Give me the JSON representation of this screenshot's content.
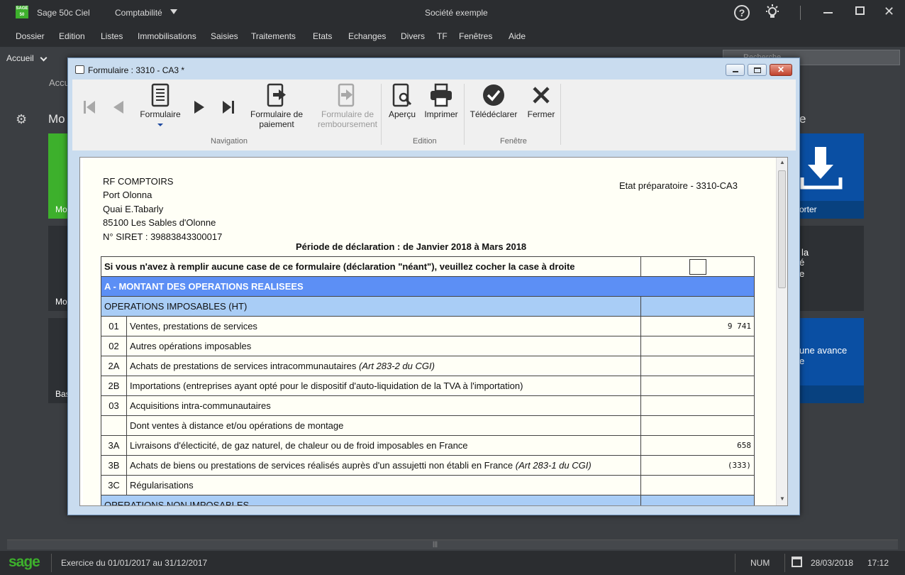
{
  "titlebar": {
    "app_name": "Sage 50c Ciel",
    "module": "Comptabilité",
    "company": "Société exemple",
    "logo_text": "SAGE 50"
  },
  "menu": {
    "items": [
      "Dossier",
      "Edition",
      "Listes",
      "Immobilisations",
      "Saisies",
      "Traitements",
      "Etats",
      "Echanges",
      "Divers",
      "TF",
      "Fenêtres",
      "Aide"
    ]
  },
  "navbar": {
    "home": "Accueil",
    "search_placeholder": "Recherche"
  },
  "background": {
    "breadcrumb": "Accu",
    "heading_left": "Mo",
    "heading_right": "e",
    "tiles": [
      {
        "label": "Mo",
        "color": "#3db02c"
      },
      {
        "label": "Mo",
        "color": "#2d3034"
      },
      {
        "label": "Bas",
        "color": "#2d3034"
      },
      {
        "label": "orter",
        "color": "#0a4fa3"
      },
      {
        "label_lines": [
          "la",
          "é",
          "e"
        ],
        "color": "#2d3034"
      },
      {
        "label_lines": [
          "une avance",
          "e"
        ],
        "color": "#0a4fa3"
      }
    ]
  },
  "modal": {
    "title": "Formulaire : 3310 - CA3 *",
    "toolbar": {
      "formulaire": "Formulaire",
      "formulaire_paiement": [
        "Formulaire de",
        "paiement"
      ],
      "formulaire_remboursement": [
        "Formulaire de",
        "remboursement"
      ],
      "apercu": "Aperçu",
      "imprimer": "Imprimer",
      "teledeclarer": "Télédéclarer",
      "fermer": "Fermer",
      "groups": {
        "navigation": "Navigation",
        "edition": "Edition",
        "fenetre": "Fenêtre"
      }
    },
    "document": {
      "address": [
        "RF COMPTOIRS",
        "Port Olonna",
        "Quai E.Tabarly",
        "85100 Les Sables d'Olonne",
        "N° SIRET : 39883843300017"
      ],
      "etat": "Etat préparatoire - 3310-CA3",
      "periode": "Période de déclaration : de Janvier 2018 à Mars 2018",
      "neant": "Si vous n'avez à remplir aucune case de ce formulaire (déclaration \"néant\"), veuillez cocher la case à droite",
      "section_a": "A - MONTANT DES OPERATIONS REALISEES",
      "subsection_imposables": "OPERATIONS IMPOSABLES (HT)",
      "rows": [
        {
          "code": "01",
          "label": "Ventes, prestations de services",
          "value": "9 741"
        },
        {
          "code": "02",
          "label": "Autres opérations imposables",
          "value": ""
        },
        {
          "code": "2A",
          "label": "Achats de prestations de services intracommunautaires",
          "italic": "(Art 283-2 du CGI)",
          "value": ""
        },
        {
          "code": "2B",
          "label": "Importations (entreprises ayant opté pour le dispositif d'auto-liquidation de la TVA à l'importation)",
          "value": ""
        },
        {
          "code": "03",
          "label": "Acquisitions intra-communautaires",
          "value": ""
        },
        {
          "code": "",
          "label": "Dont ventes à distance et/ou opérations de montage",
          "value": ""
        },
        {
          "code": "3A",
          "label": "Livraisons d'électicité, de gaz naturel, de chaleur ou de froid imposables en France",
          "value": "658"
        },
        {
          "code": "3B",
          "label": "Achats de biens ou prestations de services réalisés auprès d'un assujetti non établi en France",
          "italic": "(Art 283-1 du CGI)",
          "value": "(333)"
        },
        {
          "code": "3C",
          "label": "Régularisations",
          "value": ""
        }
      ],
      "subsection_non_imposables": "OPERATIONS NON IMPOSABLES"
    }
  },
  "statusbar": {
    "logo": "sage",
    "exercice": "Exercice du 01/01/2017 au 31/12/2017",
    "num": "NUM",
    "date": "28/03/2018",
    "time": "17:12"
  }
}
